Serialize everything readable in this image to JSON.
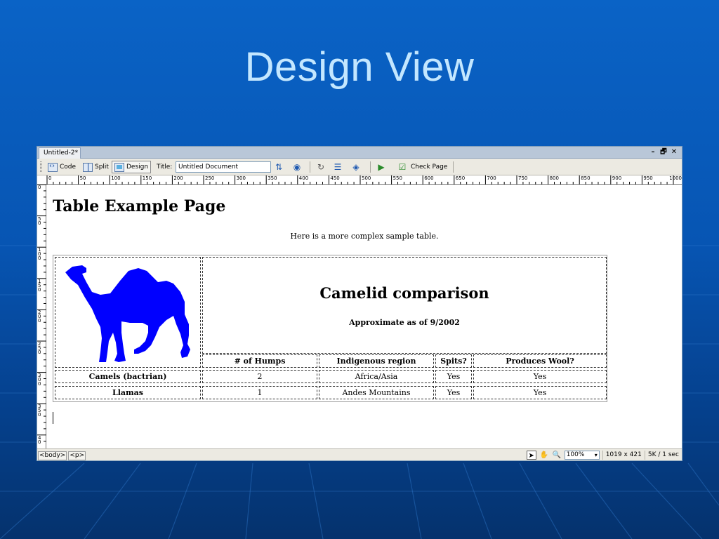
{
  "slide": {
    "title": "Design View"
  },
  "window": {
    "doc_tab": "Untitled-2*",
    "controls": {
      "minimize": "–",
      "restore": "🗗",
      "close": "✕"
    }
  },
  "toolbar": {
    "code_label": "Code",
    "split_label": "Split",
    "design_label": "Design",
    "title_label": "Title:",
    "title_value": "Untitled Document",
    "check_page_label": "Check Page",
    "icons": [
      "file-management-icon",
      "preview-in-browser-icon",
      "refresh-icon",
      "view-options-icon",
      "visual-aids-icon",
      "validate-markup-icon",
      "check-page-icon"
    ]
  },
  "ruler": {
    "h_labels": [
      "0",
      "50",
      "100",
      "150",
      "200",
      "250",
      "300",
      "350",
      "400",
      "450",
      "500",
      "550",
      "600",
      "650",
      "700",
      "750",
      "800",
      "850",
      "900",
      "950",
      "1000"
    ],
    "v_labels": [
      "0",
      "5\n0",
      "1\n0\n0",
      "1\n5\n0",
      "2\n0\n0",
      "2\n5\n0",
      "3\n0\n0",
      "3\n5\n0",
      "4\n0"
    ]
  },
  "page": {
    "heading": "Table Example Page",
    "intro": "Here is a more complex sample table.",
    "table": {
      "caption_title": "Camelid comparison",
      "caption_subtitle": "Approximate as of 9/2002",
      "image_icon": "camel-image",
      "headers": [
        "# of Humps",
        "Indigenous region",
        "Spits?",
        "Produces Wool?"
      ],
      "rows": [
        {
          "name": "Camels (bactrian)",
          "cells": [
            "2",
            "Africa/Asia",
            "Yes",
            "Yes"
          ]
        },
        {
          "name": "Llamas",
          "cells": [
            "1",
            "Andes Mountains",
            "Yes",
            "Yes"
          ]
        }
      ]
    }
  },
  "statusbar": {
    "tags": [
      "<body>",
      "<p>"
    ],
    "zoom": "100%",
    "dimensions": "1019 x 421",
    "size_time": "5K / 1 sec"
  },
  "colors": {
    "camel": "#0000ff",
    "slide_bg": "#0755b3",
    "title_text": "#c3e7ff"
  }
}
